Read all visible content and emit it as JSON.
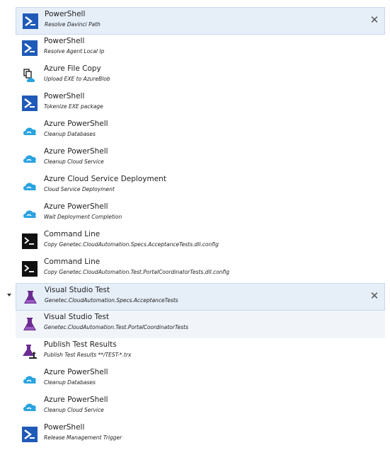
{
  "close_glyph": "✕",
  "tasks": [
    {
      "icon": "powershell-icon",
      "name": "PowerShell",
      "desc": "Resolve Davinci Path",
      "state": "selected",
      "close": true
    },
    {
      "icon": "powershell-icon",
      "name": "PowerShell",
      "desc": "Resolve Agent Local Ip",
      "state": "",
      "close": false
    },
    {
      "icon": "azure-file-copy-icon",
      "name": "Azure File Copy",
      "desc": "Upload EXE to AzureBlob",
      "state": "",
      "close": false
    },
    {
      "icon": "powershell-icon",
      "name": "PowerShell",
      "desc": "Tokenize EXE package",
      "state": "",
      "close": false
    },
    {
      "icon": "azure-cloud-icon",
      "name": "Azure PowerShell",
      "desc": "Cleanup Databases",
      "state": "",
      "close": false
    },
    {
      "icon": "azure-cloud-icon",
      "name": "Azure PowerShell",
      "desc": "Cleanup Cloud Service",
      "state": "",
      "close": false
    },
    {
      "icon": "azure-cloud-icon",
      "name": "Azure Cloud Service Deployment",
      "desc": "Cloud Service Deployment",
      "state": "",
      "close": false
    },
    {
      "icon": "azure-cloud-icon",
      "name": "Azure PowerShell",
      "desc": "Wait Deployment Completion",
      "state": "",
      "close": false
    },
    {
      "icon": "command-line-icon",
      "name": "Command Line",
      "desc": "Copy Genetec.CloudAutomation.Specs.AcceptanceTests.dll.config",
      "state": "",
      "close": false
    },
    {
      "icon": "command-line-icon",
      "name": "Command Line",
      "desc": "Copy Genetec.CloudAutomation.Test.PortalCoordinatorTests.dll.config",
      "state": "",
      "close": false
    },
    {
      "icon": "visual-studio-test-icon",
      "name": "Visual Studio Test",
      "desc": "Genetec.CloudAutomation.Specs.AcceptanceTests",
      "state": "selected",
      "close": true
    },
    {
      "icon": "visual-studio-test-icon",
      "name": "Visual Studio Test",
      "desc": "Genetec.CloudAutomation.Test.PortalCoordinatorTests",
      "state": "hover",
      "close": false
    },
    {
      "icon": "publish-test-results-icon",
      "name": "Publish Test Results",
      "desc": "Publish Test Results **/TEST-*.trx",
      "state": "",
      "close": false
    },
    {
      "icon": "azure-cloud-icon",
      "name": "Azure PowerShell",
      "desc": "Cleanup Databases",
      "state": "",
      "close": false
    },
    {
      "icon": "azure-cloud-icon",
      "name": "Azure PowerShell",
      "desc": "Cleanup Cloud Service",
      "state": "",
      "close": false
    },
    {
      "icon": "powershell-icon",
      "name": "PowerShell",
      "desc": "Release Management Trigger",
      "state": "",
      "close": false
    }
  ]
}
